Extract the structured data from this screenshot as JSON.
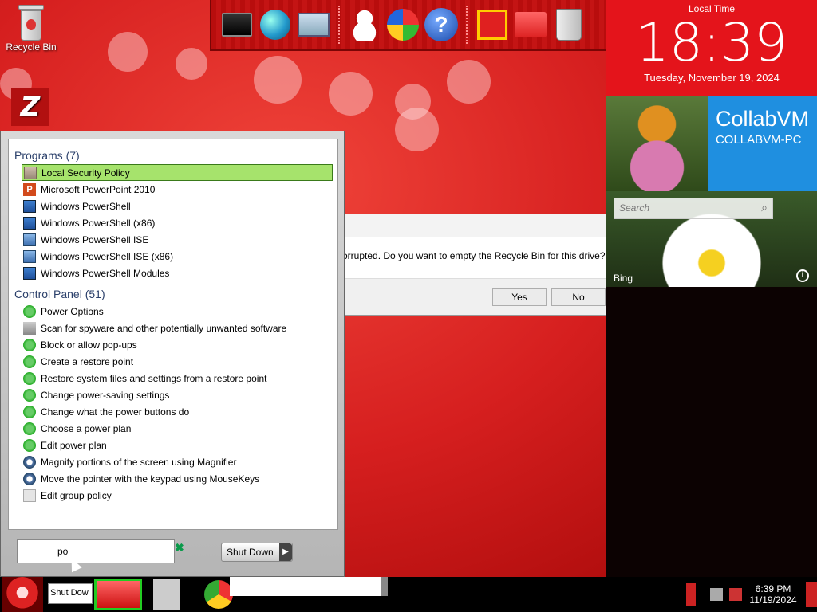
{
  "desktop": {
    "recycle_bin_label": "Recycle Bin"
  },
  "dock": {
    "icons": [
      "monitor-icon",
      "globe-icon",
      "control-panel-icon",
      "snowman-icon",
      "windows-shield-icon",
      "help-icon",
      "gift-icon",
      "folder-icon",
      "recycle-bin-icon"
    ]
  },
  "side_panel": {
    "clock_label": "Local Time",
    "time": "18:39",
    "date": "Tuesday, November 19, 2024",
    "user_name": "CollabVM",
    "computer_name": "COLLABVM-PC",
    "search_placeholder": "Search",
    "bing_label": "Bing",
    "info_glyph": "i"
  },
  "dialog": {
    "message": "orrupted. Do you want to empty the Recycle Bin for this drive?",
    "yes_label": "Yes",
    "no_label": "No"
  },
  "start_menu": {
    "programs_header": "Programs (7)",
    "programs": [
      {
        "label": "Local Security Policy",
        "icon": "security-policy-icon"
      },
      {
        "label": "Microsoft PowerPoint 2010",
        "icon": "powerpoint-icon",
        "glyph": "P"
      },
      {
        "label": "Windows PowerShell",
        "icon": "powershell-icon"
      },
      {
        "label": "Windows PowerShell (x86)",
        "icon": "powershell-icon"
      },
      {
        "label": "Windows PowerShell ISE",
        "icon": "powershell-ise-icon"
      },
      {
        "label": "Windows PowerShell ISE (x86)",
        "icon": "powershell-ise-icon"
      },
      {
        "label": "Windows PowerShell Modules",
        "icon": "powershell-icon"
      }
    ],
    "control_panel_header": "Control Panel (51)",
    "control_panel": [
      {
        "label": "Power Options"
      },
      {
        "label": "Scan for spyware and other potentially unwanted software"
      },
      {
        "label": "Block or allow pop-ups"
      },
      {
        "label": "Create a restore point"
      },
      {
        "label": "Restore system files and settings from a restore point"
      },
      {
        "label": "Change power-saving settings"
      },
      {
        "label": "Change what the power buttons do"
      },
      {
        "label": "Choose a power plan"
      },
      {
        "label": "Edit power plan"
      },
      {
        "label": "Magnify portions of the screen using Magnifier"
      },
      {
        "label": "Move the pointer with the keypad using MouseKeys"
      },
      {
        "label": "Edit group policy"
      }
    ],
    "search_value": "po",
    "shutdown_label": "Shut Down"
  },
  "taskbar": {
    "stub_label": "Shut Dow",
    "clock_time": "6:39 PM",
    "clock_date": "11/19/2024"
  }
}
